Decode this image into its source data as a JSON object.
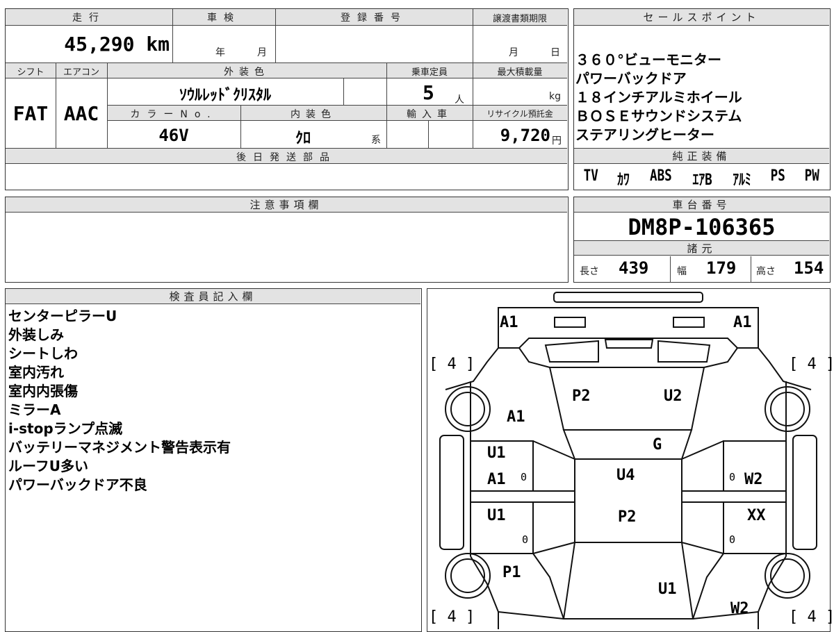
{
  "top_box": {
    "mileage_header": "走行",
    "mileage": "45,290 km",
    "inspection_header": "車検",
    "inspection_year_unit": "年",
    "inspection_month_unit": "月",
    "registration_header": "登録番号",
    "transfer_header": "譲渡書類期限",
    "transfer_month_unit": "月",
    "transfer_day_unit": "日",
    "shift_header": "シフト",
    "aircon_header": "エアコン",
    "ext_color_header": "外装色",
    "capacity_header": "乗車定員",
    "max_load_header": "最大積載量",
    "shift": "FAT",
    "aircon": "AAC",
    "ext_color": "ｿｳﾙﾚｯﾄﾞｸﾘｽﾀﾙ",
    "capacity": "5",
    "capacity_unit": "人",
    "max_load_unit": "kg",
    "color_no_header": "カラーNo.",
    "int_color_header": "内装色",
    "import_header": "輸入車",
    "recycle_header": "リサイクル預託金",
    "color_no": "46V",
    "int_color": "ｸﾛ",
    "int_color_suffix": "系",
    "recycle": "9,720",
    "recycle_unit": "円",
    "later_parts_header": "後日発送部品"
  },
  "sales_points": {
    "header": "セールスポイント",
    "items": [
      "３６０°ビューモニター",
      "パワーバックドア",
      "１８インチアルミホイール",
      "ＢＯＳＥサウンドシステム",
      "ステアリングヒーター"
    ],
    "equip_header": "純正装備",
    "equipment": [
      "TV",
      "ｶﾜ",
      "ABS",
      "ｴｱB",
      "ｱﾙﾐ",
      "PS",
      "PW"
    ]
  },
  "notes": {
    "header": "注意事項欄"
  },
  "chassis": {
    "header": "車台番号",
    "number": "DM8P-106365",
    "specs_header": "諸元",
    "length_label": "長さ",
    "length": "439",
    "width_label": "幅",
    "width": "179",
    "height_label": "高さ",
    "height": "154"
  },
  "inspector": {
    "header": "検査員記入欄",
    "remarks": [
      "センターピラーU",
      "外装しみ",
      "シートしわ",
      "室内汚れ",
      "室内内張傷",
      "ミラーA",
      "i-stopランプ点滅",
      "バッテリーマネジメント警告表示有",
      "ルーフU多い",
      "パワーバックドア不良"
    ]
  },
  "diagram": {
    "tire_fl": "[ 4 ]",
    "tire_fr": "[ 4 ]",
    "tire_rl": "[ 4 ]",
    "tire_rr": "[ 4 ]",
    "front_left": "A1",
    "front_right": "A1",
    "fender_left": "A1",
    "hood_left": "P2",
    "hood_right": "U2",
    "windshield": "G",
    "front_door_left_1": "U1",
    "front_door_left_2": "A1",
    "roof": "U4",
    "front_door_right": "W2",
    "rear_door_left": "U1",
    "roof_rear": "P2",
    "rear_door_right": "XX",
    "rear_fender_left": "P1",
    "rear_glass": "U1",
    "rear_fender_right": "W2",
    "zero_1": "0",
    "zero_2": "0",
    "zero_3": "0",
    "zero_4": "0"
  }
}
